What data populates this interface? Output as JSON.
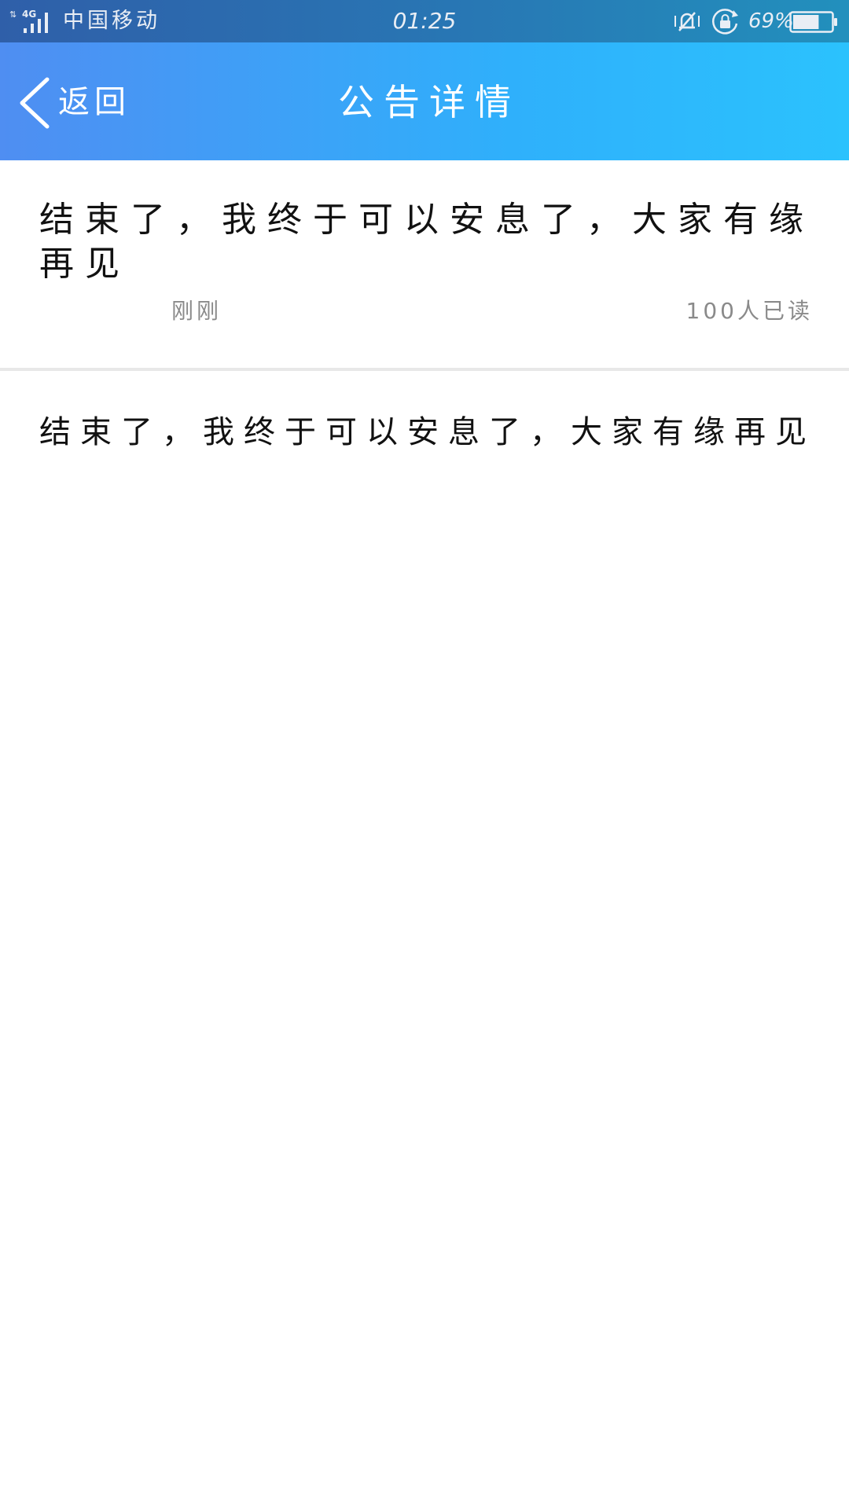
{
  "status_bar": {
    "network": "4G",
    "carrier": "中国移动",
    "time": "01:25",
    "battery_percent": "69%",
    "battery_level": 0.69,
    "icons": [
      "signal-icon",
      "mute-icon",
      "rotation-lock-icon",
      "battery-icon"
    ]
  },
  "nav": {
    "back_label": "返回",
    "title": "公告详情",
    "colors": {
      "gradient_start": "#4f8ef2",
      "gradient_end": "#2bc2fd"
    }
  },
  "notice": {
    "title": "结束了，我终于可以安息了，大家有缘再见",
    "time": "刚刚",
    "reads": "100人已读",
    "body": "结束了，我终于可以安息了，大家有缘再见"
  }
}
